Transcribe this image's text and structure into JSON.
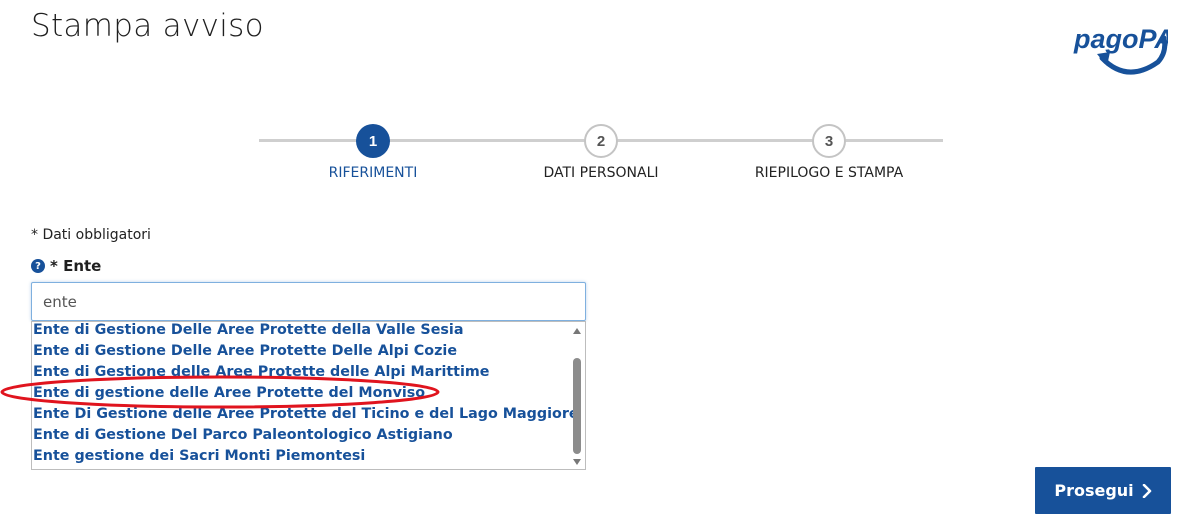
{
  "page": {
    "title": "Stampa avviso"
  },
  "brand": {
    "logo_text": "pagoPA",
    "primary_color": "#17519a",
    "annotation_color": "#e0141e"
  },
  "stepper": {
    "steps": [
      {
        "number": "1",
        "label": "RIFERIMENTI",
        "state": "active"
      },
      {
        "number": "2",
        "label": "DATI PERSONALI",
        "state": "inactive"
      },
      {
        "number": "3",
        "label": "RIEPILOGO E STAMPA",
        "state": "inactive"
      }
    ]
  },
  "form": {
    "required_note": "* Dati obbligatori",
    "ente_label": "* Ente",
    "help_icon": "question-circle-icon",
    "search_value": "ente",
    "options": [
      "Ente di Gestione Delle Aree Protette della Valle Sesia",
      "Ente di Gestione Delle Aree Protette Delle Alpi Cozie",
      "Ente di Gestione delle Aree Protette delle Alpi Marittime",
      "Ente di gestione delle Aree Protette del Monviso",
      "Ente Di Gestione delle Aree Protette del Ticino e del Lago Maggiore",
      "Ente di Gestione Del Parco Paleontologico Astigiano",
      "Ente gestione dei Sacri Monti Piemontesi"
    ],
    "highlighted_option_index": 3
  },
  "actions": {
    "next_label": "Prosegui",
    "next_icon": "chevron-right-icon"
  }
}
